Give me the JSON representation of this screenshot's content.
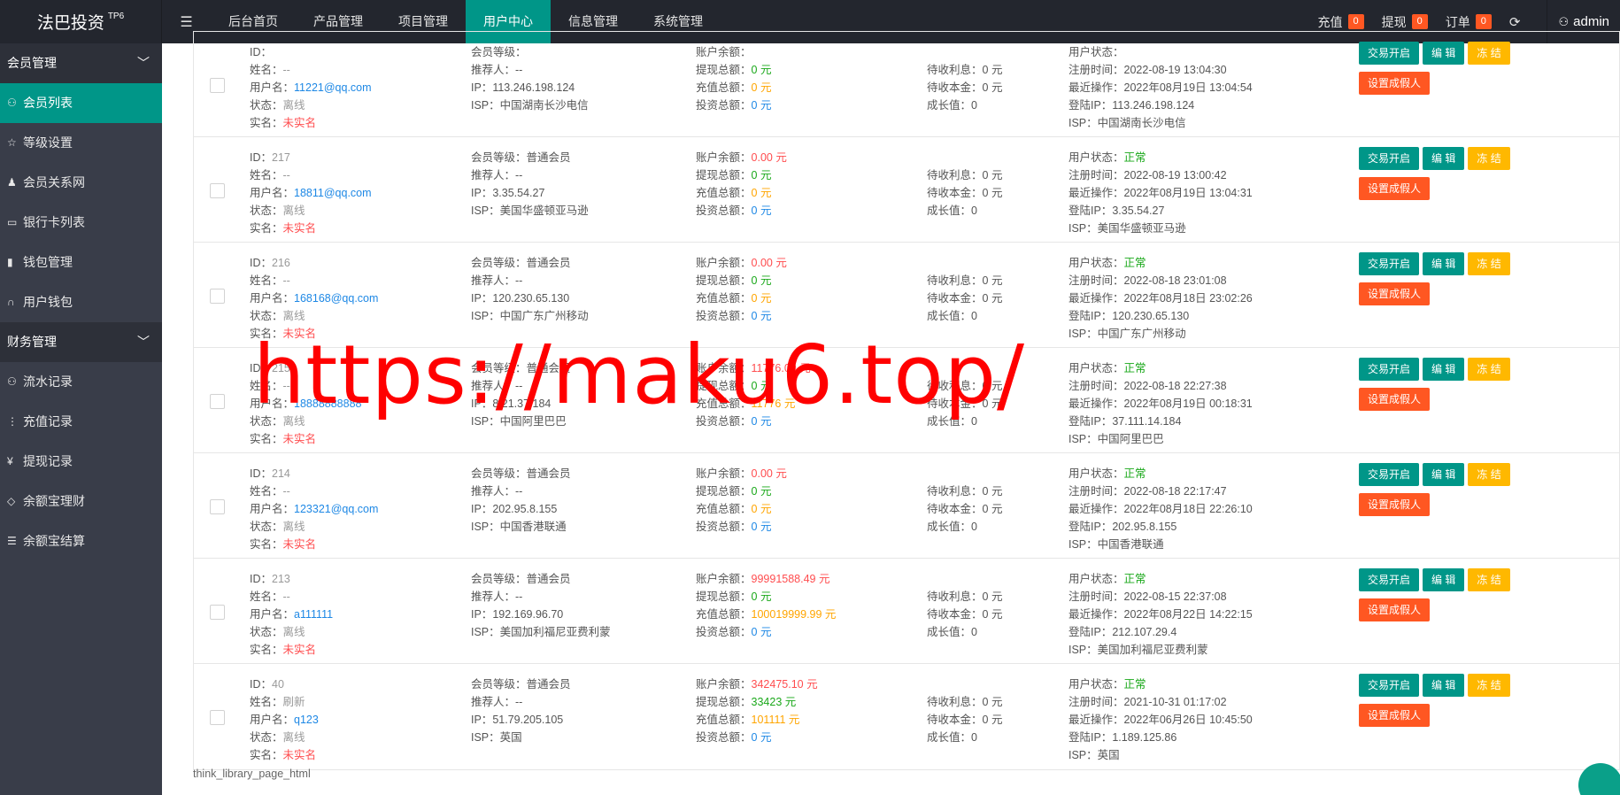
{
  "header": {
    "logo": "法巴投资",
    "logo_sup": "TP6",
    "menu_toggle_icon": "hamburger-icon",
    "nav": [
      "后台首页",
      "产品管理",
      "项目管理",
      "用户中心",
      "信息管理",
      "系统管理"
    ],
    "nav_active": "用户中心",
    "recharge_label": "充值",
    "recharge_count": "0",
    "withdraw_label": "提现",
    "withdraw_count": "0",
    "order_label": "订单",
    "order_count": "0",
    "user": "admin"
  },
  "sidebar": {
    "group1": "会员管理",
    "items1": [
      "会员列表",
      "等级设置",
      "会员关系网",
      "银行卡列表",
      "钱包管理",
      "用户钱包"
    ],
    "group2": "财务管理",
    "items2": [
      "流水记录",
      "充值记录",
      "提现记录",
      "余额宝理财",
      "余额宝结算"
    ]
  },
  "labels": {
    "id": "ID：",
    "name": "姓名：",
    "username": "用户名：",
    "status": "状态：",
    "realname": "实名：",
    "level": "会员等级：",
    "referrer": "推荐人：",
    "ip": "IP：",
    "isp": "ISP：",
    "balance": "账户余额：",
    "withdraw_total": "提现总额：",
    "recharge_total": "充值总额：",
    "invest_total": "投资总额：",
    "pending_interest": "待收利息：",
    "pending_principal": "待收本金：",
    "growth": "成长值：",
    "user_status": "用户状态：",
    "reg_time": "注册时间：",
    "last_op": "最近操作：",
    "login_ip": "登陆IP：",
    "btn_trade": "交易开启",
    "btn_edit": "编 辑",
    "btn_freeze": "冻 结",
    "btn_fake": "设置成假人"
  },
  "rows": [
    {
      "id": "",
      "name": "--",
      "username": "11221@qq.com",
      "status": "离线",
      "realname": "未实名",
      "level": "",
      "referrer": "--",
      "ip": "113.246.198.124",
      "isp": "中国湖南长沙电信",
      "balance": "",
      "withdraw": "0 元",
      "recharge": "0 元",
      "invest": "0 元",
      "interest": "0 元",
      "principal": "0 元",
      "growth": "0",
      "ustatus": "",
      "reg": "2022-08-19 13:04:30",
      "last": "2022年08月19日 13:04:54",
      "login_ip": "113.246.198.124",
      "isp2": "中国湖南长沙电信"
    },
    {
      "id": "217",
      "name": "--",
      "username": "18811@qq.com",
      "status": "离线",
      "realname": "未实名",
      "level": "普通会员",
      "referrer": "--",
      "ip": "3.35.54.27",
      "isp": "美国华盛顿亚马逊",
      "balance": "0.00 元",
      "withdraw": "0 元",
      "recharge": "0 元",
      "invest": "0 元",
      "interest": "0 元",
      "principal": "0 元",
      "growth": "0",
      "ustatus": "正常",
      "reg": "2022-08-19 13:00:42",
      "last": "2022年08月19日 13:04:31",
      "login_ip": "3.35.54.27",
      "isp2": "美国华盛顿亚马逊"
    },
    {
      "id": "216",
      "name": "--",
      "username": "168168@qq.com",
      "status": "离线",
      "realname": "未实名",
      "level": "普通会员",
      "referrer": "--",
      "ip": "120.230.65.130",
      "isp": "中国广东广州移动",
      "balance": "0.00 元",
      "withdraw": "0 元",
      "recharge": "0 元",
      "invest": "0 元",
      "interest": "0 元",
      "principal": "0 元",
      "growth": "0",
      "ustatus": "正常",
      "reg": "2022-08-18 23:01:08",
      "last": "2022年08月18日 23:02:26",
      "login_ip": "120.230.65.130",
      "isp2": "中国广东广州移动"
    },
    {
      "id": "215",
      "name": "--",
      "username": "18888888888",
      "status": "离线",
      "realname": "未实名",
      "level": "普通会员",
      "referrer": "--",
      "ip": "8.21.37.184",
      "isp": "中国阿里巴巴",
      "balance": "11776.00 元",
      "withdraw": "0 元",
      "recharge": "11776 元",
      "invest": "0 元",
      "interest": "0 元",
      "principal": "0 元",
      "growth": "0",
      "ustatus": "正常",
      "reg": "2022-08-18 22:27:38",
      "last": "2022年08月19日 00:18:31",
      "login_ip": "37.111.14.184",
      "isp2": "中国阿里巴巴"
    },
    {
      "id": "214",
      "name": "--",
      "username": "123321@qq.com",
      "status": "离线",
      "realname": "未实名",
      "level": "普通会员",
      "referrer": "--",
      "ip": "202.95.8.155",
      "isp": "中国香港联通",
      "balance": "0.00 元",
      "withdraw": "0 元",
      "recharge": "0 元",
      "invest": "0 元",
      "interest": "0 元",
      "principal": "0 元",
      "growth": "0",
      "ustatus": "正常",
      "reg": "2022-08-18 22:17:47",
      "last": "2022年08月18日 22:26:10",
      "login_ip": "202.95.8.155",
      "isp2": "中国香港联通"
    },
    {
      "id": "213",
      "name": "--",
      "username": "a111111",
      "status": "离线",
      "realname": "未实名",
      "level": "普通会员",
      "referrer": "--",
      "ip": "192.169.96.70",
      "isp": "美国加利福尼亚费利蒙",
      "balance": "99991588.49 元",
      "withdraw": "0 元",
      "recharge": "100019999.99 元",
      "invest": "0 元",
      "interest": "0 元",
      "principal": "0 元",
      "growth": "0",
      "ustatus": "正常",
      "reg": "2022-08-15 22:37:08",
      "last": "2022年08月22日 14:22:15",
      "login_ip": "212.107.29.4",
      "isp2": "美国加利福尼亚费利蒙"
    },
    {
      "id": "40",
      "name": "刷新",
      "username": "q123",
      "status": "离线",
      "realname": "未实名",
      "level": "普通会员",
      "referrer": "--",
      "ip": "51.79.205.105",
      "isp": "英国",
      "balance": "342475.10 元",
      "withdraw": "33423 元",
      "recharge": "101111 元",
      "invest": "0 元",
      "interest": "0 元",
      "principal": "0 元",
      "growth": "0",
      "ustatus": "正常",
      "reg": "2021-10-31 01:17:02",
      "last": "2022年06月26日 10:45:50",
      "login_ip": "1.189.125.86",
      "isp2": "英国"
    }
  ],
  "footer": "think_library_page_html",
  "watermark": "https://maku6.top/"
}
